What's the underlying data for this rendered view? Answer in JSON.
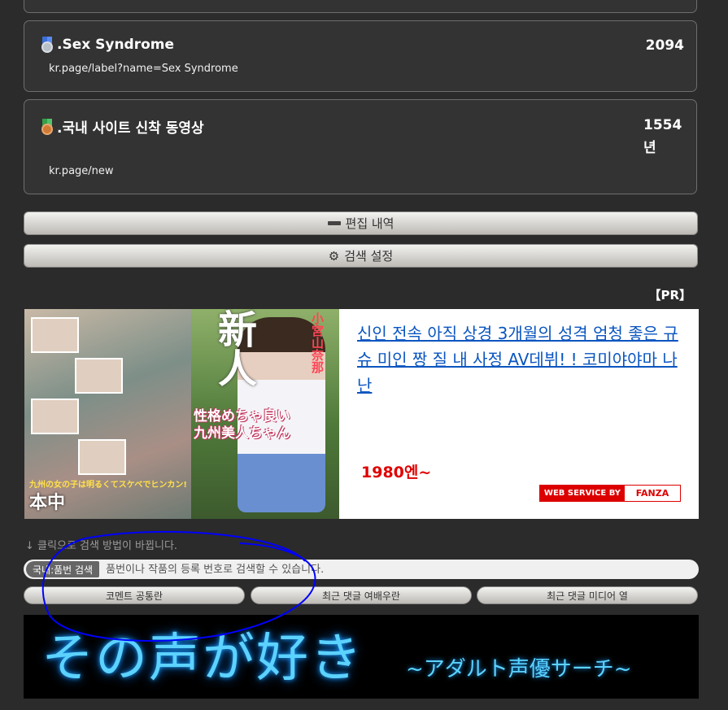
{
  "rankings": [
    {
      "medal": "silver-medal",
      "title": ".Sex Syndrome",
      "count": "2094",
      "url": "kr.page/label?name=Sex Syndrome"
    },
    {
      "medal": "bronze-medal",
      "title": ".국내 사이트 신착 동영상",
      "count": "1554\n년",
      "url": "kr.page/new"
    }
  ],
  "buttons": {
    "edit_history": "편집 내역",
    "search_settings": "검색 설정"
  },
  "pr_label": "【PR】",
  "ad": {
    "cover_big": "新人",
    "cover_promo": "性格めちゃ良い\n九州美人ちゃん",
    "cover_logo": "本中",
    "cover_yellow": "九州の女の子は明るくてスケベでヒンカン!",
    "cover_name": "小宮山奈那",
    "title": "신인 전속 아직 상경 3개월의 성격 엄청 좋은 규슈 미인 짱 질 내 사정 AV데뷔! ! 코미야야마 나난",
    "price": "1980엔~",
    "service_label": "WEB SERVICE BY",
    "service_brand": "FANZA"
  },
  "search": {
    "hint": "↓ 클릭으로 검색 방법이 바뀝니다.",
    "mode": "국내:품번 검색",
    "placeholder": "품번이나 작품의 등록 번호로 검색할 수 있습니다."
  },
  "links": [
    "코멘트 공통란",
    "최근 댓글 여배우란",
    "최근 댓글 미디어 열"
  ],
  "banner": {
    "main": "その声が好き",
    "sub": "~アダルト声優サーチ~"
  },
  "colors": {
    "background": "#2b2b2b",
    "link": "#0a55c0",
    "price": "#e00000",
    "annotation": "#0000ff"
  }
}
